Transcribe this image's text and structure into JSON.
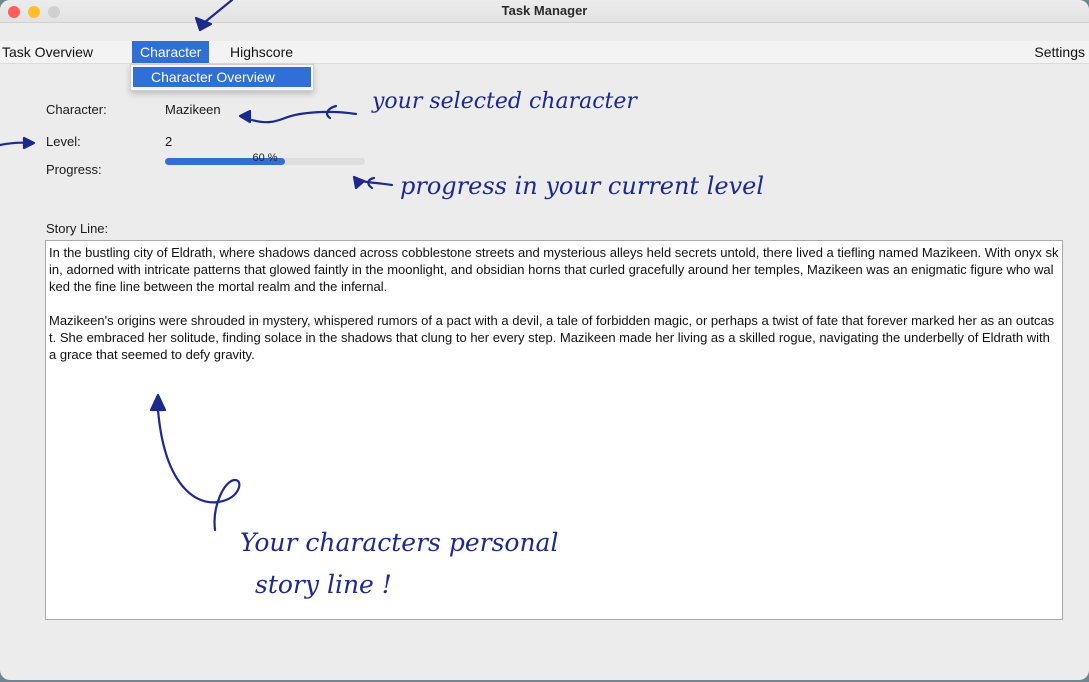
{
  "window": {
    "title": "Task Manager"
  },
  "menu": {
    "items": [
      "Task Overview",
      "Character",
      "Highscore"
    ],
    "settings": "Settings",
    "active_index": 1
  },
  "dropdown": {
    "items": [
      "Character Overview"
    ]
  },
  "character": {
    "label_character": "Character:",
    "name": "Mazikeen",
    "label_level": "Level:",
    "level": "2",
    "label_progress": "Progress:",
    "progress_value": 0.6,
    "progress_text": "60 %"
  },
  "story": {
    "label": "Story Line:",
    "paragraphs": [
      "In the bustling city of Eldrath, where shadows danced across cobblestone streets and mysterious alleys held secrets untold, there lived a tiefling named Mazikeen. With onyx skin, adorned with intricate patterns that glowed faintly in the moonlight, and obsidian horns that curled gracefully around her temples, Mazikeen was an enigmatic figure who walked the fine line between the mortal realm and the infernal.",
      "Mazikeen's origins were shrouded in mystery, whispered rumors of a pact with a devil, a tale of forbidden magic, or perhaps a twist of fate that forever marked her as an outcast. She embraced her solitude, finding solace in the shadows that clung to her every step. Mazikeen made her living as a skilled rogue, navigating the underbelly of Eldrath with a grace that seemed to defy gravity."
    ]
  },
  "annotations": {
    "selected": "your selected character",
    "progress": "progress in your current level",
    "story_line1": "Your characters personal",
    "story_line2": "story line !"
  },
  "colors": {
    "accent": "#2f6fd6",
    "annotation": "#1b2a8c",
    "close": "#ff5f57",
    "minimize": "#febc2e",
    "zoom": "#d0d0d0"
  }
}
